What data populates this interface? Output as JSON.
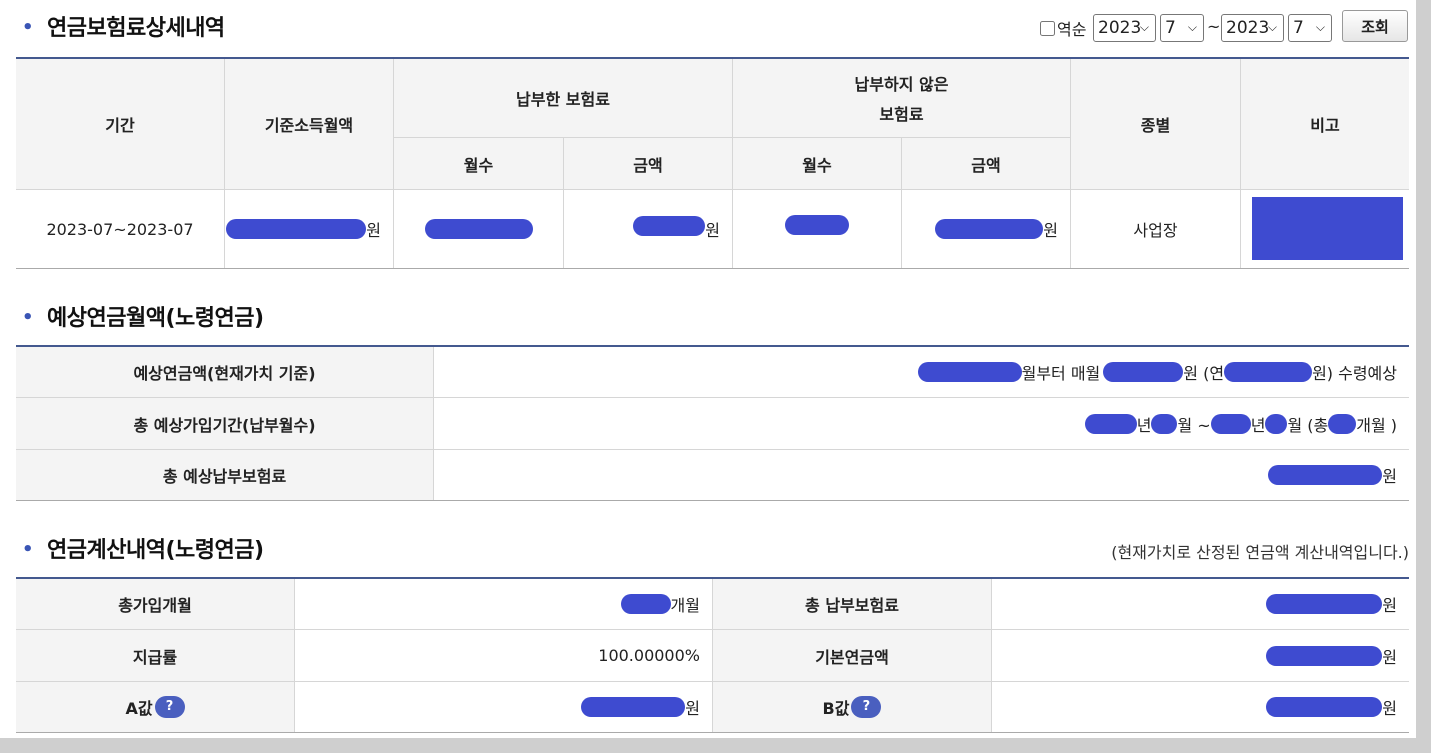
{
  "section1": {
    "title": "연금보험료상세내역",
    "reverse_label": "역순",
    "from_year": "2023",
    "from_month": "7",
    "tilde": "~",
    "to_year": "2023",
    "to_month": "7",
    "search_button": "조회",
    "headers": {
      "period": "기간",
      "base_income": "기준소득월액",
      "paid": "납부한 보험료",
      "unpaid_line1": "납부하지 않은",
      "unpaid_line2": "보험료",
      "type": "종별",
      "note": "비고",
      "months": "월수",
      "amount": "금액"
    },
    "row": {
      "period": "2023-07~2023-07",
      "won": "원",
      "type": "사업장"
    }
  },
  "section2": {
    "title": "예상연금월액(노령연금)",
    "rows": [
      {
        "label": "예상연금액(현재가치 기준)",
        "t1": "월부터 매월",
        "t2": "원 (연",
        "t3": "원) 수령예상"
      },
      {
        "label": "총 예상가입기간(납부월수)",
        "y1": "년",
        "m1": "월 ~",
        "y2": "년",
        "m2": "월 (총",
        "end": "개월 )"
      },
      {
        "label": "총 예상납부보험료",
        "won": "원"
      }
    ]
  },
  "section3": {
    "title": "연금계산내역(노령연금)",
    "note": "(현재가치로 산정된 연금액 계산내역입니다.)",
    "total_months_label": "총가입개월",
    "total_months_unit": "개월",
    "total_premium_label": "총 납부보험료",
    "payment_rate_label": "지급률",
    "payment_rate_value": "100.00000%",
    "base_pension_label": "기본연금액",
    "a_label": "A값",
    "b_label": "B값",
    "help": "?",
    "won": "원"
  },
  "colors": {
    "accent": "#3e4bd0",
    "rule": "#44598f"
  }
}
